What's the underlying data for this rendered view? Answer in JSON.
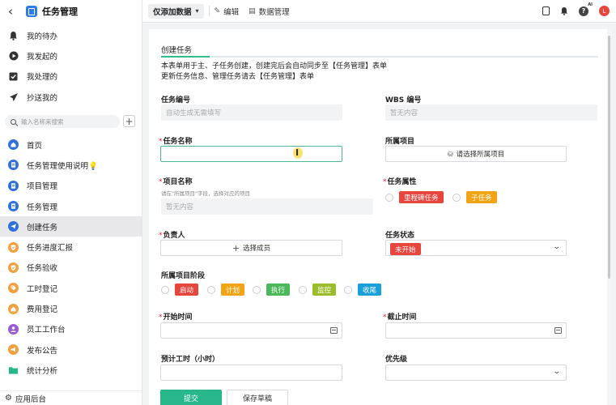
{
  "sidebar": {
    "back_icon": "chevron-left-icon",
    "title": "任务管理",
    "top_items": [
      {
        "label": "我的待办",
        "icon": "bell-icon"
      },
      {
        "label": "我发起的",
        "icon": "send-circle-icon"
      },
      {
        "label": "我处理的",
        "icon": "check-box-icon"
      },
      {
        "label": "抄送我的",
        "icon": "paper-plane-icon"
      }
    ],
    "search": {
      "placeholder": "输入名称来搜索"
    },
    "menu": [
      {
        "label": "首页",
        "icon": "home-icon",
        "color": "#2f6fde"
      },
      {
        "label": "任务管理使用说明💡",
        "icon": "document-icon",
        "color": "#2f6fde"
      },
      {
        "label": "项目管理",
        "icon": "document-icon",
        "color": "#2f6fde"
      },
      {
        "label": "任务管理",
        "icon": "document-icon",
        "color": "#2f6fde"
      },
      {
        "label": "创建任务",
        "icon": "send-icon",
        "color": "#2f6fde"
      },
      {
        "label": "任务进度汇报",
        "icon": "shield-check-icon",
        "color": "#f2a03d"
      },
      {
        "label": "任务验收",
        "icon": "shield-check-icon",
        "color": "#f2a03d"
      },
      {
        "label": "工时登记",
        "icon": "tag-icon",
        "color": "#f2a03d"
      },
      {
        "label": "费用登记",
        "icon": "home-icon",
        "color": "#f2a03d"
      },
      {
        "label": "员工工作台",
        "icon": "user-icon",
        "color": "#9b59d6"
      },
      {
        "label": "发布公告",
        "icon": "megaphone-icon",
        "color": "#f2a03d"
      },
      {
        "label": "统计分析",
        "icon": "folder-icon",
        "color": "#27b78b"
      }
    ],
    "active_index": 4,
    "footer": {
      "label": "应用后台",
      "icon": "gear-icon"
    }
  },
  "toolbar": {
    "view_label": "仅添加数据",
    "edit_label": "编辑",
    "data_manage_label": "数据管理",
    "help_badge": "AI",
    "avatar_letter": "L"
  },
  "form": {
    "tab_label": "创建任务",
    "description_lines": [
      "本表单用于主、子任务创建，创建完后会自动同步至【任务管理】表单",
      "更新任务信息、管理任务请去【任务管理】表单"
    ],
    "fields": {
      "task_no": {
        "label": "任务编号",
        "placeholder": "自动生成无需填写"
      },
      "wbs_no": {
        "label": "WBS 编号",
        "placeholder": "暂无内容"
      },
      "task_name": {
        "label": "任务名称",
        "required": true,
        "value": ""
      },
      "project": {
        "label": "所属项目",
        "button": "请选择所属项目"
      },
      "project_name": {
        "label": "项目名称",
        "required": true,
        "hint": "请在\"所属项目\"字段，选择对应的项目",
        "placeholder": "暂无内容"
      },
      "task_attr": {
        "label": "任务属性",
        "required": true,
        "options": [
          {
            "label": "里程碑任务",
            "color": "#e8453c"
          },
          {
            "label": "子任务",
            "color": "#f2a417"
          }
        ]
      },
      "owner": {
        "label": "负责人",
        "required": true,
        "button": "选择成员"
      },
      "status": {
        "label": "任务状态",
        "value": "未开始",
        "color": "#e8453c"
      },
      "stage": {
        "label": "所属项目阶段",
        "options": [
          {
            "label": "启动",
            "color": "#e8453c"
          },
          {
            "label": "计划",
            "color": "#f2a417"
          },
          {
            "label": "执行",
            "color": "#4cb85c"
          },
          {
            "label": "监控",
            "color": "#9bbd2b"
          },
          {
            "label": "收尾",
            "color": "#1aa0d8"
          }
        ]
      },
      "start_time": {
        "label": "开始时间",
        "required": true
      },
      "end_time": {
        "label": "截止时间",
        "required": true
      },
      "est_hours": {
        "label": "预计工时（小时）"
      },
      "priority": {
        "label": "优先级"
      }
    },
    "submit_label": "提交",
    "draft_label": "保存草稿"
  }
}
